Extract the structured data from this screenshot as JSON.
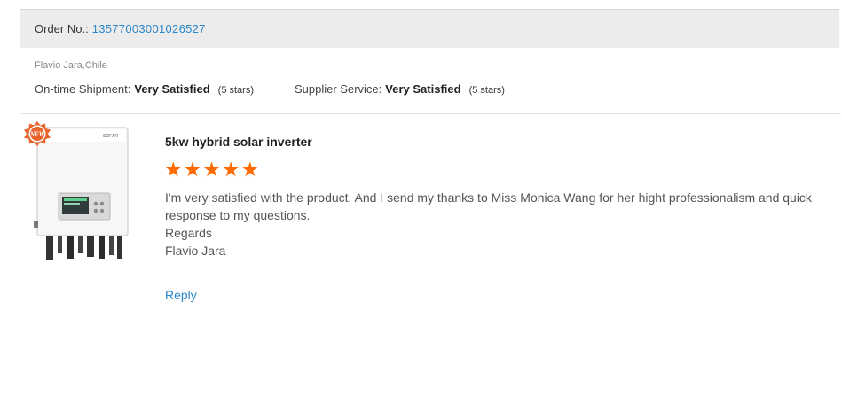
{
  "order": {
    "label": "Order No.:",
    "number": "13577003001026527"
  },
  "reviewer": {
    "name_location": "Flavio Jara,Chile"
  },
  "ratings": [
    {
      "label": "On-time Shipment:",
      "value": "Very Satisfied",
      "stars_text": "(5 stars)",
      "stars": 5
    },
    {
      "label": "Supplier Service:",
      "value": "Very Satisfied",
      "stars_text": "(5 stars)",
      "stars": 5
    }
  ],
  "product": {
    "title": "5kw hybrid solar inverter",
    "badge": "NEW",
    "brand_mark": "SOFAR",
    "image_icon": "inverter-product-image"
  },
  "review": {
    "rating": 5,
    "lines": [
      "I'm very satisfied with the product. And I send my thanks to Miss Monica Wang for her hight professionalism and quick response to my questions.",
      "Regards",
      "Flavio Jara"
    ]
  },
  "actions": {
    "reply_label": "Reply"
  },
  "colors": {
    "link": "#2a86c9",
    "star": "#ff6a00",
    "badge": "#e8642c",
    "order_bar": "#ececec"
  }
}
